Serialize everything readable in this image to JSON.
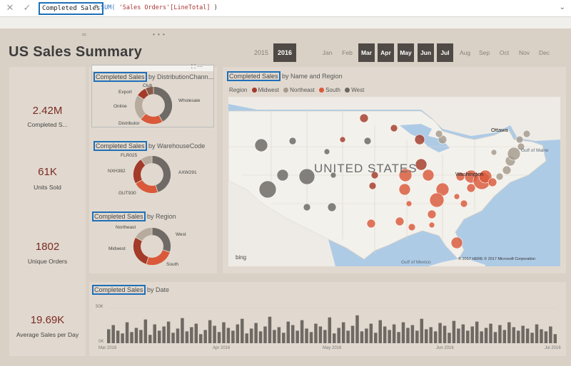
{
  "formula_bar": {
    "cancel_icon": "close-icon",
    "commit_icon": "check-icon",
    "measure_name": "Completed Sales",
    "equals": "=",
    "func": "SUM(",
    "arg": " 'Sales Orders'[LineTotal] ",
    "close": ")"
  },
  "report": {
    "title": "US Sales Summary"
  },
  "slicer": {
    "years": [
      "2015",
      "2016"
    ],
    "selected_year": "2016",
    "months": [
      "Jan",
      "Feb",
      "Mar",
      "Apr",
      "May",
      "Jun",
      "Jul",
      "Aug",
      "Sep",
      "Oct",
      "Nov",
      "Dec"
    ],
    "selected_months": [
      "Mar",
      "Apr",
      "May",
      "Jun",
      "Jul"
    ]
  },
  "kpis": [
    {
      "value": "2.42M",
      "label": "Completed S..."
    },
    {
      "value": "61K",
      "label": "Units Sold"
    },
    {
      "value": "1802",
      "label": "Unique Orders"
    },
    {
      "value": "19.69K",
      "label": "Average Sales per Day"
    }
  ],
  "donut_channel": {
    "title_hl": "Completed Sales",
    "title_rest": " by DistributionChann...",
    "labels": {
      "club": "Club",
      "export": "Export",
      "online": "Online",
      "distributor": "Distributor",
      "wholesale": "Wholesale"
    }
  },
  "donut_warehouse": {
    "title_hl": "Completed Sales",
    "title_rest": " by WarehouseCode",
    "labels": {
      "flr": "FLR025",
      "nxh": "NXH382",
      "gut": "GUT930",
      "axw": "AXW291"
    }
  },
  "donut_region": {
    "title_hl": "Completed Sales",
    "title_rest": " by Region",
    "labels": {
      "northeast": "Northeast",
      "west": "West",
      "midwest": "Midwest",
      "south": "South"
    }
  },
  "map": {
    "title_hl": "Completed Sales",
    "title_rest": " by Name and Region",
    "legend_title": "Region",
    "legend": [
      {
        "name": "Midwest",
        "color": "#a33a2a"
      },
      {
        "name": "Northeast",
        "color": "#a59a8c"
      },
      {
        "name": "South",
        "color": "#d9593a"
      },
      {
        "name": "West",
        "color": "#6a6663"
      }
    ],
    "country_label": "UNITED STATES",
    "city_ottawa": "Ottawa",
    "city_washington": "Washington",
    "water_gulf_maine": "Gulf of\nMaine",
    "water_gulf_mexico": "Gulf of Mexico",
    "bing": "bing",
    "copyright": "© 2017 HERE  © 2017 Microsoft Corporation"
  },
  "date_chart": {
    "title_hl": "Completed Sales",
    "title_rest": " by Date",
    "y_labels": [
      "50K",
      "0K"
    ],
    "x_labels": [
      "Mar 2016",
      "Apr 2016",
      "May 2016",
      "Jun 2016",
      "Jul 2016"
    ]
  },
  "chart_data": [
    {
      "type": "pie",
      "title": "Completed Sales by DistributionChann...",
      "categories": [
        "Wholesale",
        "Distributor",
        "Online",
        "Export",
        "Club"
      ],
      "values": [
        42,
        20,
        22,
        9,
        7
      ],
      "colors": [
        "#706a66",
        "#d9593a",
        "#b7ab9e",
        "#a33a2a",
        "#8a5a4a"
      ]
    },
    {
      "type": "pie",
      "title": "Completed Sales by WarehouseCode",
      "categories": [
        "AXW291",
        "GUT930",
        "NXH382",
        "FLR025"
      ],
      "values": [
        45,
        22,
        23,
        10
      ],
      "colors": [
        "#706a66",
        "#d9593a",
        "#a33a2a",
        "#b7ab9e"
      ]
    },
    {
      "type": "pie",
      "title": "Completed Sales by Region",
      "categories": [
        "West",
        "South",
        "Midwest",
        "Northeast"
      ],
      "values": [
        30,
        25,
        28,
        17
      ],
      "colors": [
        "#706a66",
        "#d9593a",
        "#a33a2a",
        "#b7ab9e"
      ]
    },
    {
      "type": "bar",
      "title": "Completed Sales by Date",
      "y_unit": "K",
      "ylim": [
        0,
        50
      ],
      "values": [
        20,
        26,
        18,
        14,
        30,
        16,
        22,
        19,
        34,
        12,
        27,
        18,
        24,
        31,
        15,
        21,
        36,
        17,
        23,
        28,
        13,
        19,
        33,
        25,
        16,
        30,
        22,
        18,
        27,
        35,
        14,
        21,
        29,
        17,
        24,
        38,
        19,
        23,
        15,
        31,
        26,
        18,
        33,
        21,
        16,
        28,
        24,
        19,
        37,
        14,
        22,
        30,
        18,
        25,
        40,
        17,
        21,
        28,
        15,
        33,
        24,
        19,
        27,
        16,
        30,
        22,
        26,
        18,
        35,
        20,
        23,
        17,
        29,
        25,
        15,
        32,
        21,
        27,
        18,
        24,
        31,
        17,
        22,
        28,
        16,
        26,
        19,
        30,
        23,
        18,
        25,
        21,
        15,
        27,
        20,
        17,
        24,
        13
      ]
    }
  ]
}
